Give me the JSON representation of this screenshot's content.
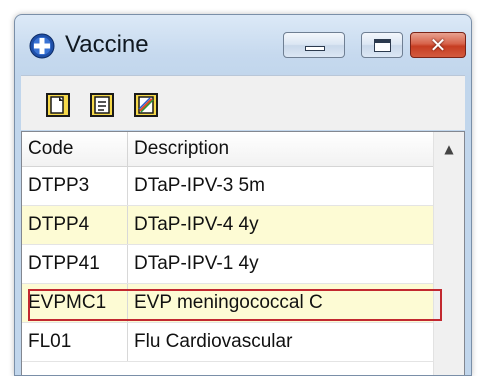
{
  "window": {
    "title": "Vaccine"
  },
  "toolbar": {
    "buttons": [
      "new-record-icon",
      "edit-record-icon",
      "report-icon"
    ]
  },
  "grid": {
    "columns": {
      "code": "Code",
      "description": "Description"
    },
    "rows": [
      {
        "code": "DTPP3",
        "description": "DTaP-IPV-3 5m"
      },
      {
        "code": "DTPP4",
        "description": "DTaP-IPV-4 4y"
      },
      {
        "code": "DTPP41",
        "description": "DTaP-IPV-1 4y"
      },
      {
        "code": "EVPMC1",
        "description": "EVP meningococcal C"
      },
      {
        "code": "FL01",
        "description": "Flu Cardiovascular"
      }
    ]
  },
  "colors": {
    "row_alt": "#fdfbd4",
    "highlight_border": "#c2282f",
    "close_button": "#c63d22"
  }
}
